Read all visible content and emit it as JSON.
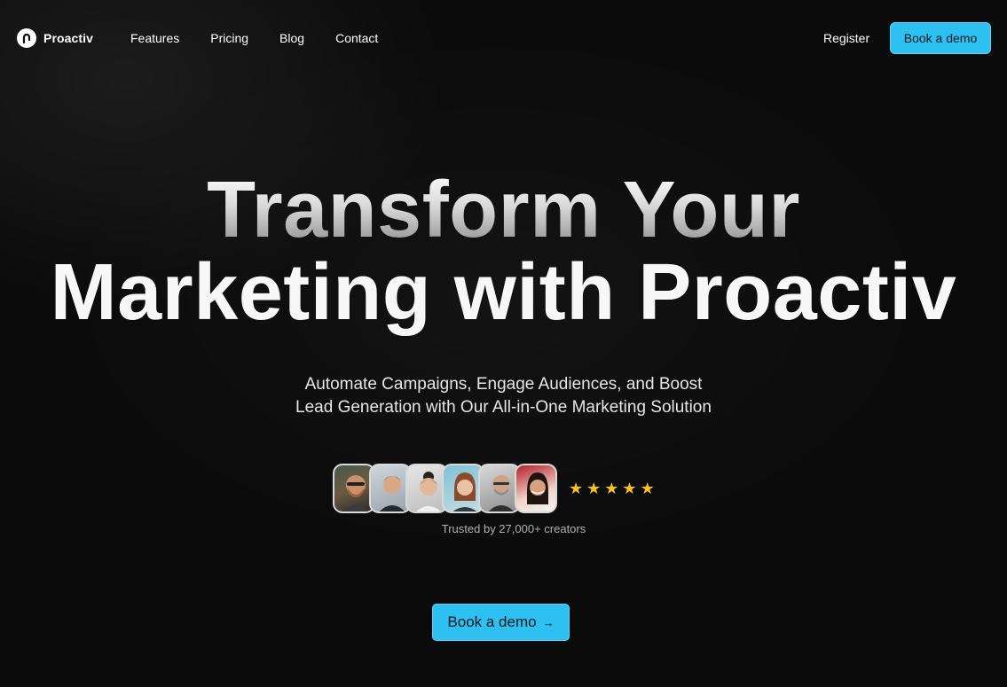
{
  "brand": {
    "name": "Proactiv",
    "logo_icon": "proactiv-logo-icon"
  },
  "nav": {
    "links": [
      "Features",
      "Pricing",
      "Blog",
      "Contact"
    ],
    "register_label": "Register",
    "cta_label": "Book a demo"
  },
  "hero": {
    "headline_line1": "Transform Your",
    "headline_line2": "Marketing with Proactiv",
    "subtitle_line1": "Automate Campaigns, Engage Audiences, and Boost",
    "subtitle_line2": "Lead Generation with Our All-in-One Marketing Solution",
    "rating_stars": 5,
    "star_icon": "star-icon",
    "trusted_text": "Trusted by 27,000+ creators",
    "cta_label": "Book a demo",
    "cta_icon": "arrow-right-icon",
    "cta_arrow": "→"
  },
  "colors": {
    "background": "#0b0b0c",
    "accent": "#2ec0f0",
    "star": "#f6c21c"
  }
}
